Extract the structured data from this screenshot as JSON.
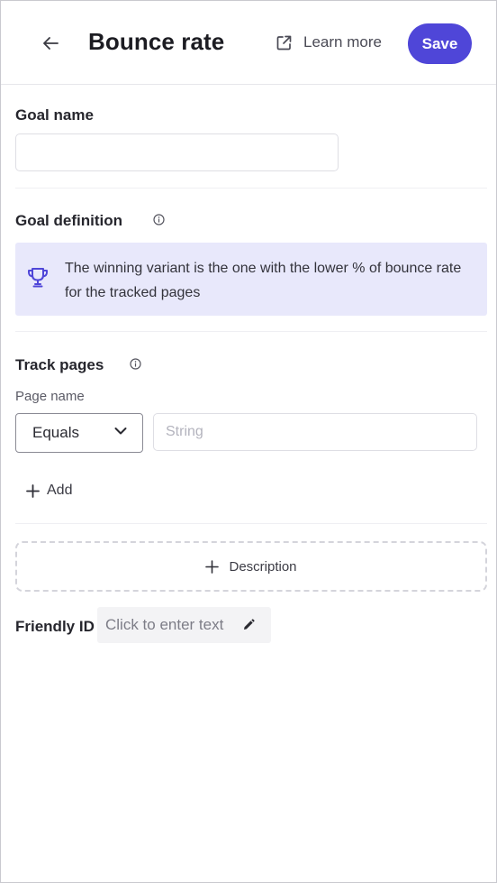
{
  "colors": {
    "accent": "#4f46d8",
    "callout_bg": "#e8e8fb",
    "trophy": "#4f46d8"
  },
  "header": {
    "back_icon": "arrow-left-icon",
    "title": "Bounce rate",
    "learn_more_icon": "external-link-icon",
    "learn_more_label": "Learn more",
    "save_label": "Save"
  },
  "goal_name": {
    "label": "Goal name",
    "value": "",
    "placeholder": ""
  },
  "goal_definition": {
    "label": "Goal definition",
    "info_icon": "info-icon",
    "callout_icon": "trophy-icon",
    "callout_text": "The winning variant is the one with the lower % of bounce rate for the tracked pages"
  },
  "track_pages": {
    "label": "Track pages",
    "info_icon": "info-icon",
    "page_name_label": "Page name",
    "operator_selected": "Equals",
    "value": "",
    "value_placeholder": "String",
    "add_label": "Add"
  },
  "description": {
    "button_label": "Description"
  },
  "friendly_id": {
    "label": "Friendly ID",
    "placeholder": "Click to enter text",
    "edit_icon": "pencil-icon"
  }
}
